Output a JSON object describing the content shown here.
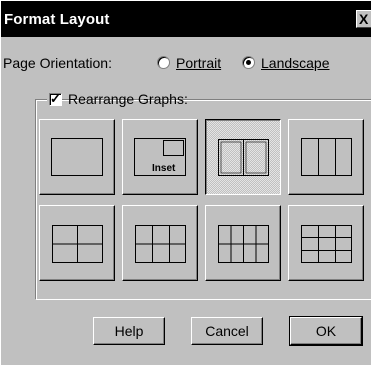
{
  "window": {
    "title": "Format Layout",
    "close_glyph": "X"
  },
  "orientation": {
    "label": "Page Orientation:",
    "options": [
      {
        "label": "Portrait",
        "selected": false
      },
      {
        "label": "Landscape",
        "selected": true
      }
    ]
  },
  "rearrange": {
    "label": "Rearrange Graphs:",
    "checked": true,
    "check_glyph": "✓"
  },
  "layouts": [
    {
      "name": "single-graph",
      "selected": false,
      "inset_label": ""
    },
    {
      "name": "graph-with-inset",
      "selected": false,
      "inset_label": "Inset"
    },
    {
      "name": "two-columns",
      "selected": true,
      "inset_label": ""
    },
    {
      "name": "three-columns",
      "selected": false,
      "inset_label": ""
    },
    {
      "name": "2x2-grid",
      "selected": false,
      "inset_label": ""
    },
    {
      "name": "3x2-grid",
      "selected": false,
      "inset_label": ""
    },
    {
      "name": "4x2-grid",
      "selected": false,
      "inset_label": ""
    },
    {
      "name": "3x3-grid",
      "selected": false,
      "inset_label": ""
    }
  ],
  "buttons": {
    "help": "Help",
    "cancel": "Cancel",
    "ok": "OK"
  }
}
